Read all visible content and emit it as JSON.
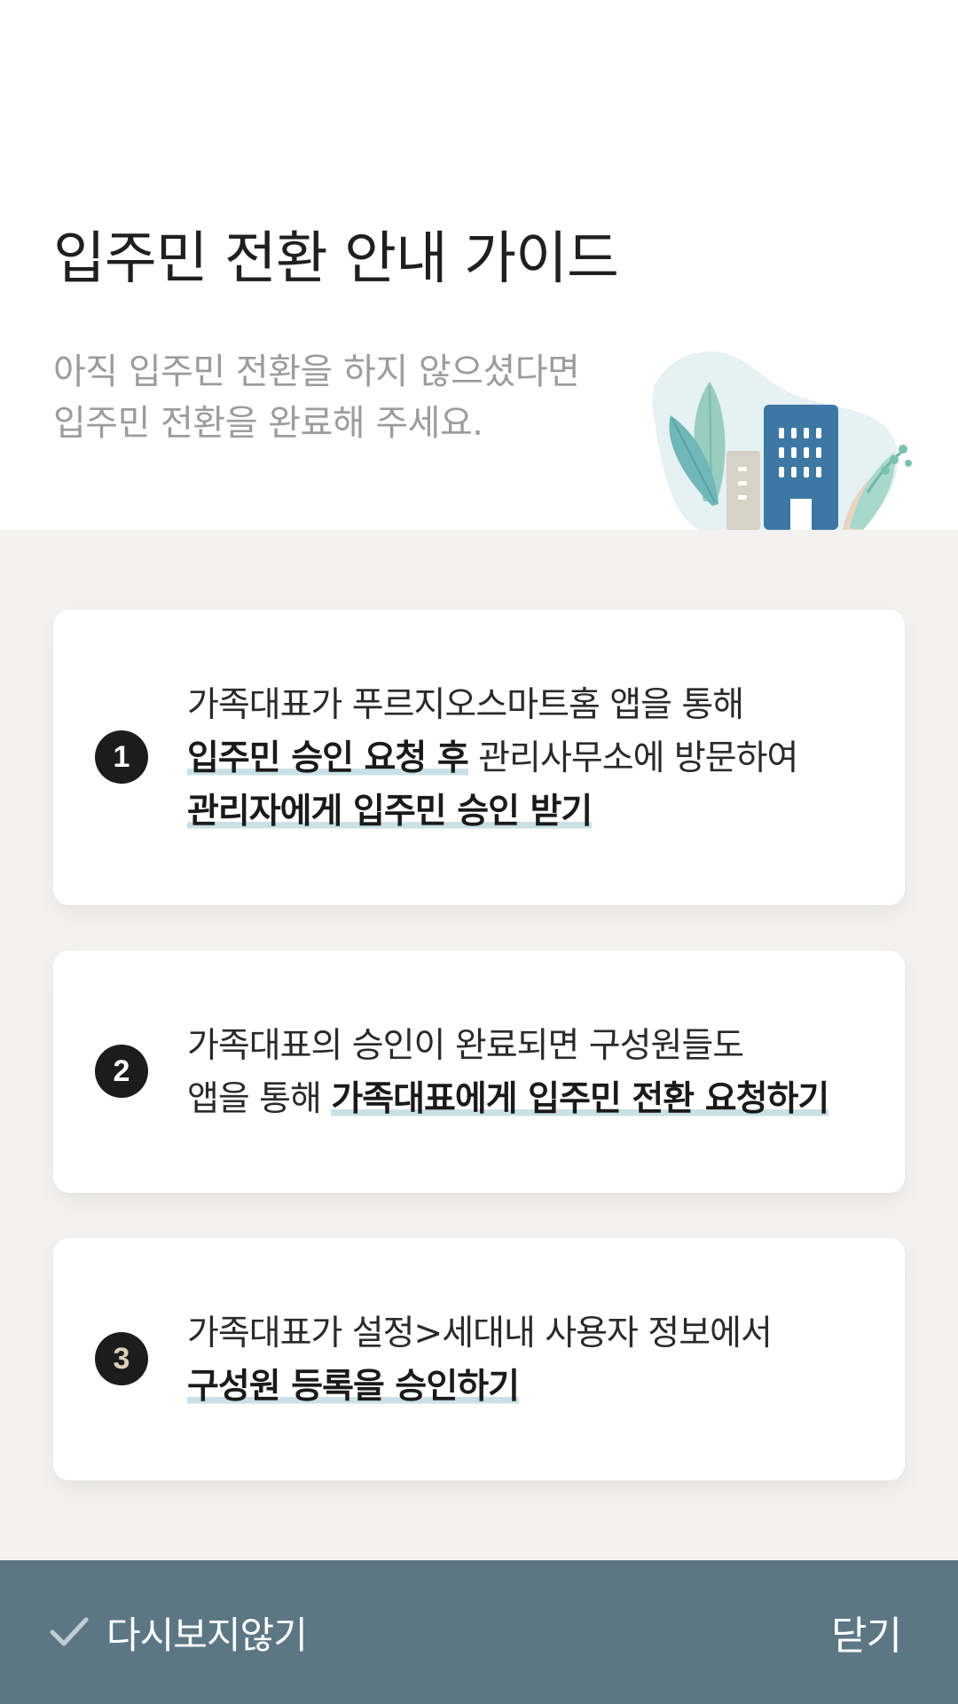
{
  "header": {
    "title": "입주민 전환 안내 가이드",
    "subtitle_line1": "아직 입주민 전환을 하지 않으셨다면",
    "subtitle_line2": "입주민 전환을 완료해 주세요."
  },
  "steps": [
    {
      "number": "1",
      "line1": "가족대표가 푸르지오스마트홈 앱을 통해",
      "line2_bold": "입주민 승인 요청 후",
      "line2_rest": " 관리사무소에 방문하여",
      "line3_bold": "관리자에게 입주민 승인 받기"
    },
    {
      "number": "2",
      "line1": "가족대표의 승인이 완료되면 구성원들도",
      "line2_prefix": "앱을 통해 ",
      "line2_bold": "가족대표에게 입주민 전환 요청하기"
    },
    {
      "number": "3",
      "line1": "가족대표가 설정>세대내 사용자 정보에서",
      "line2_bold": "구성원 등록을 승인하기"
    }
  ],
  "footer": {
    "dont_show_label": "다시보지않기",
    "close_label": "닫기"
  },
  "colors": {
    "body_background": "#f3f2f0",
    "footer_background": "#5d7684",
    "highlight": "#c9e1e6",
    "building": "#3d77a3"
  },
  "icons": {
    "checkbox": "check-icon",
    "illustration": "building-plants-illustration"
  }
}
